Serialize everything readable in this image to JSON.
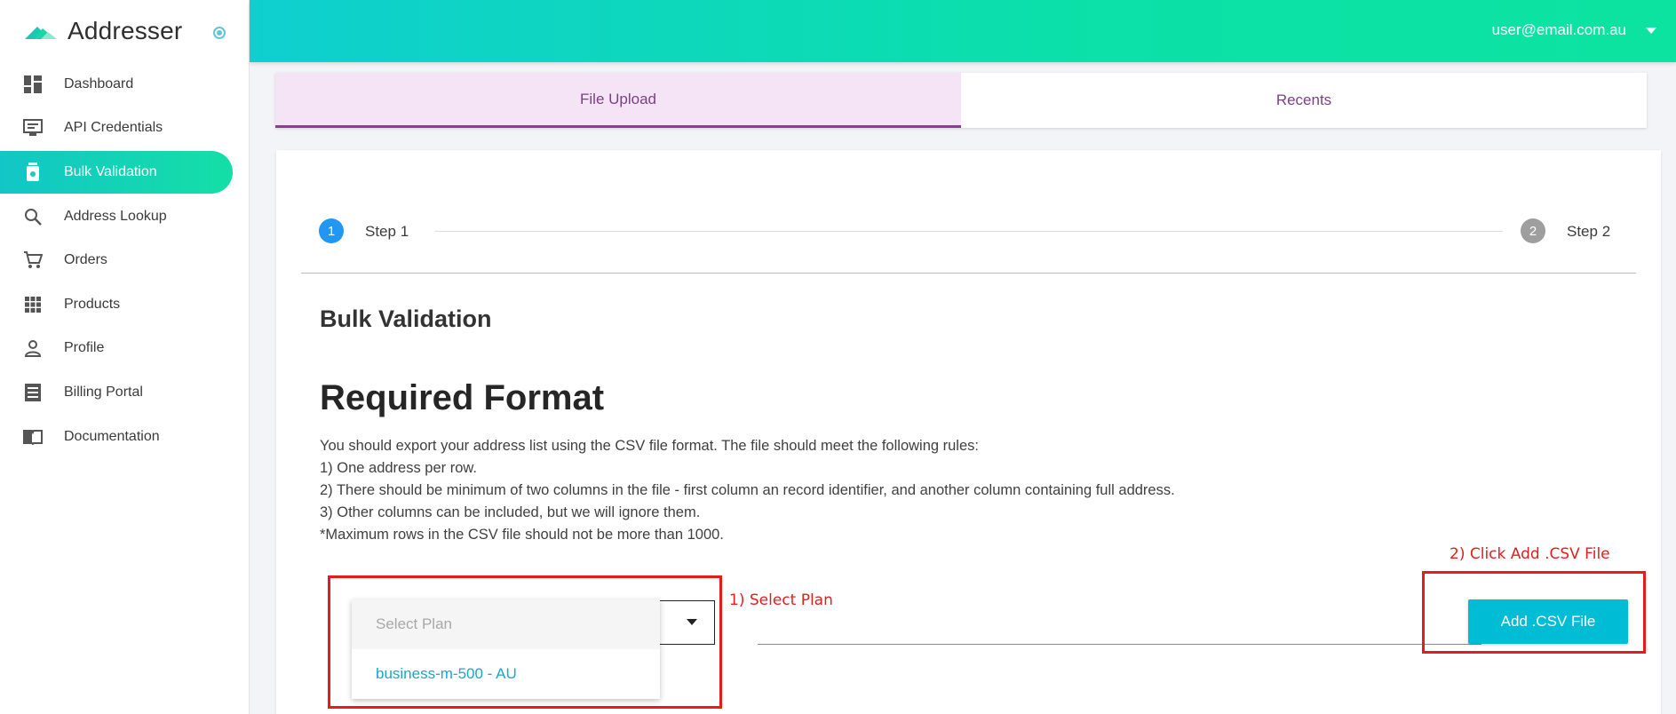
{
  "app": {
    "name": "Addresser"
  },
  "sidebar": {
    "items": [
      {
        "label": "Dashboard",
        "icon": "dashboard-icon"
      },
      {
        "label": "API Credentials",
        "icon": "api-credentials-icon"
      },
      {
        "label": "Bulk Validation",
        "icon": "bulk-validation-icon",
        "active": true
      },
      {
        "label": "Address Lookup",
        "icon": "search-icon"
      },
      {
        "label": "Orders",
        "icon": "cart-icon"
      },
      {
        "label": "Products",
        "icon": "grid-icon"
      },
      {
        "label": "Profile",
        "icon": "person-icon"
      },
      {
        "label": "Billing Portal",
        "icon": "receipt-icon"
      },
      {
        "label": "Documentation",
        "icon": "book-icon"
      }
    ]
  },
  "header": {
    "user_email": "user@email.com.au"
  },
  "tabs": [
    {
      "label": "File Upload",
      "active": true
    },
    {
      "label": "Recents",
      "active": false
    }
  ],
  "stepper": {
    "steps": [
      {
        "number": "1",
        "label": "Step 1",
        "active": true
      },
      {
        "number": "2",
        "label": "Step 2",
        "active": false
      }
    ]
  },
  "main": {
    "section_title": "Bulk Validation",
    "format_title": "Required Format",
    "rules": [
      "You should export your address list using the CSV file format. The file should meet the following rules:",
      "1) One address per row.",
      "2) There should be minimum of two columns in the file - first column an record identifier, and another column containing full address.",
      "3) Other columns can be included, but we will ignore them.",
      "*Maximum rows in the CSV file should not be more than 1000."
    ],
    "plan_select": {
      "placeholder": "Select Plan",
      "options": [
        "business-m-500 - AU"
      ]
    },
    "add_csv_label": "Add .CSV File"
  },
  "annotations": {
    "select_plan": "1) Select Plan",
    "add_csv": "2) Click Add .CSV File",
    "color": "#e81b1b"
  },
  "colors": {
    "accent_gradient_start": "#0fcfcf",
    "accent_gradient_end": "#0be1a8",
    "tab_active_bg": "#f5e4f5",
    "tab_text": "#7b3f86",
    "button": "#00bcd4",
    "step_active": "#2196f3",
    "step_inactive": "#9e9e9e"
  }
}
